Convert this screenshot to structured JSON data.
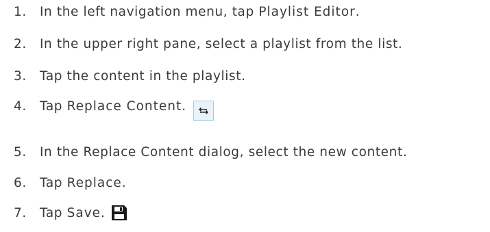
{
  "steps": [
    {
      "number": "1.",
      "text_before": "In the left navigation menu, tap ",
      "term": "Playlist Editor",
      "text_after": "."
    },
    {
      "number": "2.",
      "text": "In the upper right pane, select a playlist from the list."
    },
    {
      "number": "3.",
      "text": "Tap the content in the playlist."
    },
    {
      "number": "4.",
      "text_before": "Tap ",
      "term": "Replace Content",
      "text_after": ".",
      "icon": "replace-arrows-icon"
    },
    {
      "number": "5.",
      "text": "In the Replace Content dialog, select the new content."
    },
    {
      "number": "6.",
      "text_before": "Tap ",
      "term": "Replace",
      "text_after": "."
    },
    {
      "number": "7.",
      "text_before": "Tap ",
      "term": "Save",
      "text_after": ".",
      "icon": "save-icon"
    }
  ],
  "colors": {
    "text": "#3a3a3a",
    "icon_box_border": "#9fcbe6",
    "icon_box_fill": "#e8f3fb",
    "icon_dark": "#1a1a1a"
  }
}
